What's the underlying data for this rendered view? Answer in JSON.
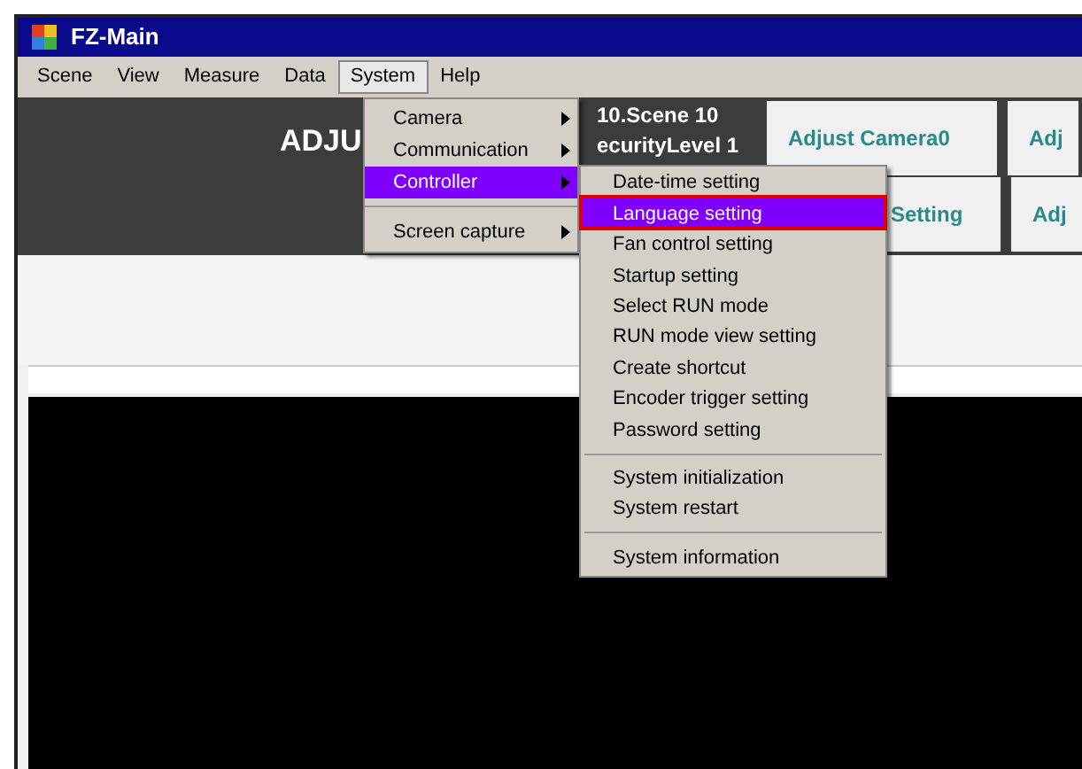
{
  "window": {
    "title": "FZ-Main"
  },
  "menu_bar": [
    {
      "label": "Scene",
      "selected": false
    },
    {
      "label": "View",
      "selected": false
    },
    {
      "label": "Measure",
      "selected": false
    },
    {
      "label": "Data",
      "selected": false
    },
    {
      "label": "System",
      "selected": true
    },
    {
      "label": "Help",
      "selected": false
    }
  ],
  "header": {
    "title": "ADJU",
    "scene": "10.Scene 10",
    "security": "ecurityLevel 1",
    "buttons": [
      [
        "Adjust Camera0",
        "Adj"
      ],
      [
        "Setting",
        "Adj"
      ]
    ]
  },
  "system_menu": [
    {
      "kind": "item",
      "label": "Camera",
      "submenu": true,
      "selected": false
    },
    {
      "kind": "item",
      "label": "Communication",
      "submenu": true,
      "selected": false
    },
    {
      "kind": "item",
      "label": "Controller",
      "submenu": true,
      "selected": true
    },
    {
      "kind": "separator"
    },
    {
      "kind": "item",
      "label": "Screen capture",
      "submenu": true,
      "selected": false
    }
  ],
  "controller_menu": [
    {
      "kind": "item",
      "label": "Date-time setting",
      "selected": false
    },
    {
      "kind": "item",
      "label": "Language setting",
      "selected": true
    },
    {
      "kind": "item",
      "label": "Fan control setting",
      "selected": false
    },
    {
      "kind": "item",
      "label": "Startup setting",
      "selected": false
    },
    {
      "kind": "item",
      "label": "Select RUN mode",
      "selected": false
    },
    {
      "kind": "item",
      "label": "RUN mode view setting",
      "selected": false
    },
    {
      "kind": "item",
      "label": "Create shortcut",
      "selected": false
    },
    {
      "kind": "item",
      "label": "Encoder trigger setting",
      "selected": false
    },
    {
      "kind": "item",
      "label": "Password setting",
      "selected": false
    },
    {
      "kind": "separator"
    },
    {
      "kind": "item",
      "label": "System initialization",
      "selected": false
    },
    {
      "kind": "item",
      "label": "System restart",
      "selected": false
    },
    {
      "kind": "separator"
    },
    {
      "kind": "item",
      "label": "System information",
      "selected": false
    }
  ]
}
